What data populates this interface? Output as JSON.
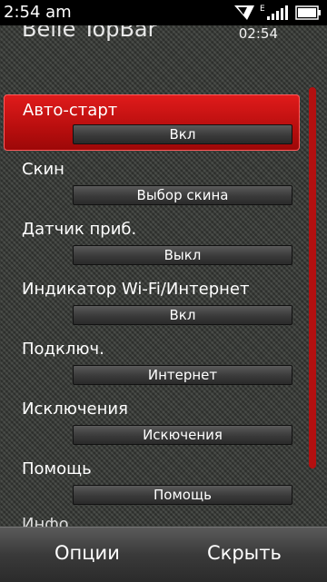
{
  "status": {
    "time": "2:54 am",
    "network": "E"
  },
  "app": {
    "title": "Belle TopBar",
    "clock": "02:54"
  },
  "items": [
    {
      "label": "Авто-старт",
      "value": "Вкл"
    },
    {
      "label": "Скин",
      "value": "Выбор скина"
    },
    {
      "label": "Датчик приб.",
      "value": "Выкл"
    },
    {
      "label": "Индикатор Wi-Fi/Интернет",
      "value": "Вкл"
    },
    {
      "label": "Подключ.",
      "value": "Интернет"
    },
    {
      "label": "Исключения",
      "value": "Искючения"
    },
    {
      "label": "Помощь",
      "value": "Помощь"
    }
  ],
  "peek_label": "Инфо",
  "softkeys": {
    "left": "Опции",
    "right": "Скрыть"
  }
}
